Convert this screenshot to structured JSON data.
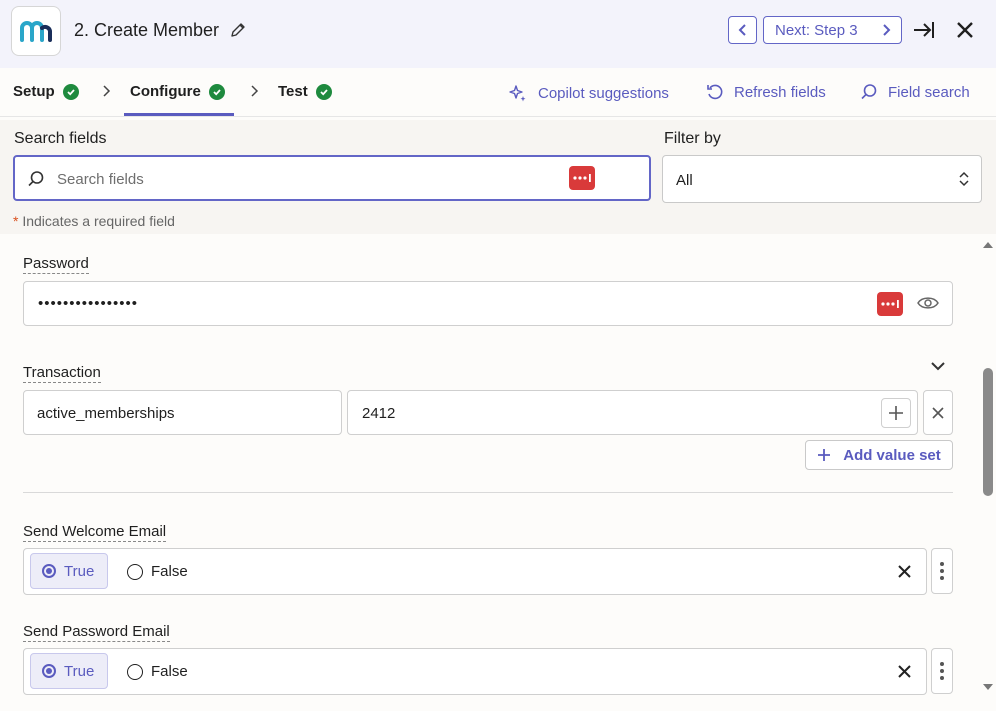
{
  "header": {
    "step_title": "2. Create Member",
    "next_label": "Next: Step 3"
  },
  "tabs": [
    {
      "label": "Setup"
    },
    {
      "label": "Configure"
    },
    {
      "label": "Test"
    }
  ],
  "actions": {
    "copilot": "Copilot suggestions",
    "refresh": "Refresh fields",
    "field_search": "Field search"
  },
  "search": {
    "label": "Search fields",
    "placeholder": "Search fields",
    "filter_label": "Filter by",
    "filter_value": "All"
  },
  "required_note": {
    "star": "*",
    "text": " Indicates a required field"
  },
  "fields": {
    "password": {
      "label": "Password",
      "value": "••••••••••••••••"
    },
    "transaction": {
      "label": "Transaction",
      "key": "active_memberships",
      "value": "2412",
      "add_label": "Add value set"
    },
    "send_welcome": {
      "label": "Send Welcome Email",
      "true_label": "True",
      "false_label": "False",
      "selected": "True"
    },
    "send_password": {
      "label": "Send Password Email",
      "true_label": "True",
      "false_label": "False",
      "selected": "True"
    }
  },
  "colors": {
    "accent": "#5a5bbf",
    "success": "#1e8a3e",
    "password_manager": "#d93a3a",
    "required_star": "#d9501e"
  }
}
